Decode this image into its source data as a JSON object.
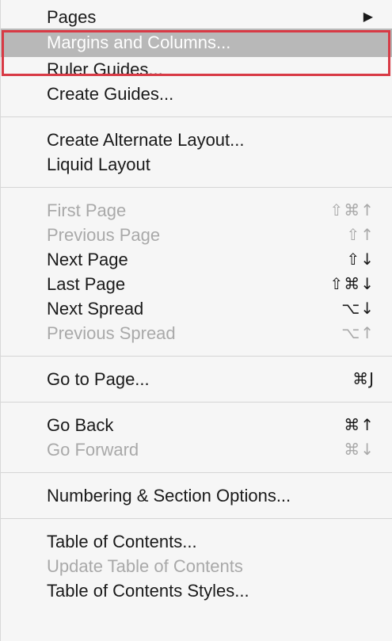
{
  "menu": {
    "groups": [
      {
        "items": [
          {
            "label": "Pages",
            "shortcut": "",
            "submenu": true,
            "disabled": false,
            "highlight": false
          },
          {
            "label": "Margins and Columns...",
            "shortcut": "",
            "submenu": false,
            "disabled": false,
            "highlight": true
          },
          {
            "label": "Ruler Guides...",
            "shortcut": "",
            "submenu": false,
            "disabled": false,
            "highlight": false
          },
          {
            "label": "Create Guides...",
            "shortcut": "",
            "submenu": false,
            "disabled": false,
            "highlight": false
          }
        ]
      },
      {
        "items": [
          {
            "label": "Create Alternate Layout...",
            "shortcut": "",
            "submenu": false,
            "disabled": false,
            "highlight": false
          },
          {
            "label": "Liquid Layout",
            "shortcut": "",
            "submenu": false,
            "disabled": false,
            "highlight": false
          }
        ]
      },
      {
        "items": [
          {
            "label": "First Page",
            "shortcut": "⇧⌘↑",
            "submenu": false,
            "disabled": true,
            "highlight": false
          },
          {
            "label": "Previous Page",
            "shortcut": "⇧↑",
            "submenu": false,
            "disabled": true,
            "highlight": false
          },
          {
            "label": "Next Page",
            "shortcut": "⇧↓",
            "submenu": false,
            "disabled": false,
            "highlight": false
          },
          {
            "label": "Last Page",
            "shortcut": "⇧⌘↓",
            "submenu": false,
            "disabled": false,
            "highlight": false
          },
          {
            "label": "Next Spread",
            "shortcut": "⌥↓",
            "submenu": false,
            "disabled": false,
            "highlight": false
          },
          {
            "label": "Previous Spread",
            "shortcut": "⌥↑",
            "submenu": false,
            "disabled": true,
            "highlight": false
          }
        ]
      },
      {
        "items": [
          {
            "label": "Go to Page...",
            "shortcut": "⌘J",
            "submenu": false,
            "disabled": false,
            "highlight": false
          }
        ]
      },
      {
        "items": [
          {
            "label": "Go Back",
            "shortcut": "⌘↑",
            "submenu": false,
            "disabled": false,
            "highlight": false
          },
          {
            "label": "Go Forward",
            "shortcut": "⌘↓",
            "submenu": false,
            "disabled": true,
            "highlight": false
          }
        ]
      },
      {
        "items": [
          {
            "label": "Numbering & Section Options...",
            "shortcut": "",
            "submenu": false,
            "disabled": false,
            "highlight": false
          }
        ]
      },
      {
        "items": [
          {
            "label": "Table of Contents...",
            "shortcut": "",
            "submenu": false,
            "disabled": false,
            "highlight": false
          },
          {
            "label": "Update Table of Contents",
            "shortcut": "",
            "submenu": false,
            "disabled": true,
            "highlight": false
          },
          {
            "label": "Table of Contents Styles...",
            "shortcut": "",
            "submenu": false,
            "disabled": false,
            "highlight": false
          }
        ]
      }
    ],
    "submenu_icon": "triangle-right-icon",
    "colors": {
      "highlight_bg": "#b8b8b8",
      "focus_border": "#d83a45",
      "disabled_text": "#a9a9a9"
    }
  }
}
